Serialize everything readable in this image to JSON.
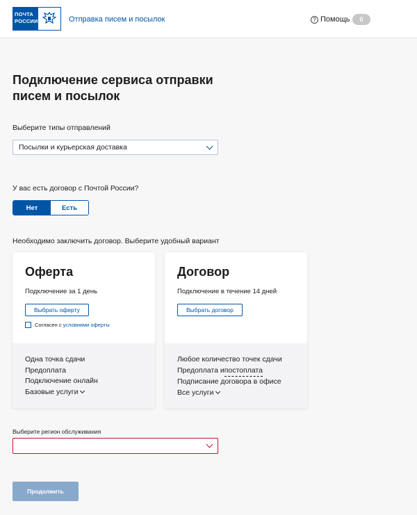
{
  "header": {
    "logo_line1": "ПОЧТА",
    "logo_line2": "РОССИИ",
    "service_link": "Отправка писем и посылок",
    "help_label": "Помощь",
    "help_icon": "question-icon",
    "counter": "0"
  },
  "main": {
    "title": "Подключение сервиса отправки писем и посылок",
    "shipment_types_label": "Выберите типы отправлений",
    "shipment_types_value": "Посылки и курьерская доставка",
    "contract_question": "У вас есть договор с Почтой России?",
    "toggle": {
      "no": "Нет",
      "yes": "Есть",
      "selected": "Нет"
    },
    "contract_hint": "Необходимо заключить договор. Выберите удобный вариант"
  },
  "cards": [
    {
      "title": "Оферта",
      "subtitle": "Подключение за 1 день",
      "button": "Выбрать оферту",
      "checkbox_prefix": "Согласен с ",
      "checkbox_link": "условиями оферты",
      "features": [
        "Одна точка сдачи",
        "Предоплата",
        "Подключение онлайн",
        "Базовые услуги"
      ]
    },
    {
      "title": "Договор",
      "subtitle": "Подключение в течение 14 дней",
      "button": "Выбрать договор",
      "features": [
        "Любое количество точек сдачи",
        "Предоплата и ",
        "постоплата",
        "Подписание договора в офисе",
        "Все услуги"
      ]
    }
  ],
  "region": {
    "label": "Выберите регион обслуживания",
    "value": ""
  },
  "actions": {
    "continue": "Продолжить"
  },
  "colors": {
    "brand": "#0055a6",
    "error": "#c8102e",
    "disabled_button": "#88a9cc"
  }
}
